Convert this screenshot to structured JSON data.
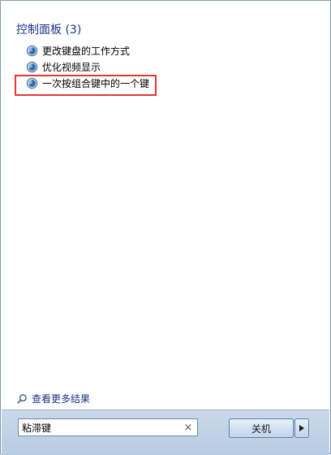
{
  "results": {
    "section_header": "控制面板 (3)",
    "items": [
      {
        "label": "更改键盘的工作方式",
        "icon": "control-panel-icon"
      },
      {
        "label": "优化视频显示",
        "icon": "control-panel-icon"
      },
      {
        "label": "一次按组合键中的一个键",
        "icon": "control-panel-icon"
      }
    ],
    "highlighted_index": 2,
    "see_more": {
      "label": "查看更多结果",
      "icon": "search-icon"
    }
  },
  "search": {
    "value": "粘滞键",
    "clear_glyph": "×"
  },
  "shutdown": {
    "label": "关机",
    "arrow_icon": "triangle-right-icon"
  },
  "colors": {
    "header": "#1e3287",
    "highlight_border": "#e53935",
    "bottom_bar": "#c9d9ea"
  }
}
